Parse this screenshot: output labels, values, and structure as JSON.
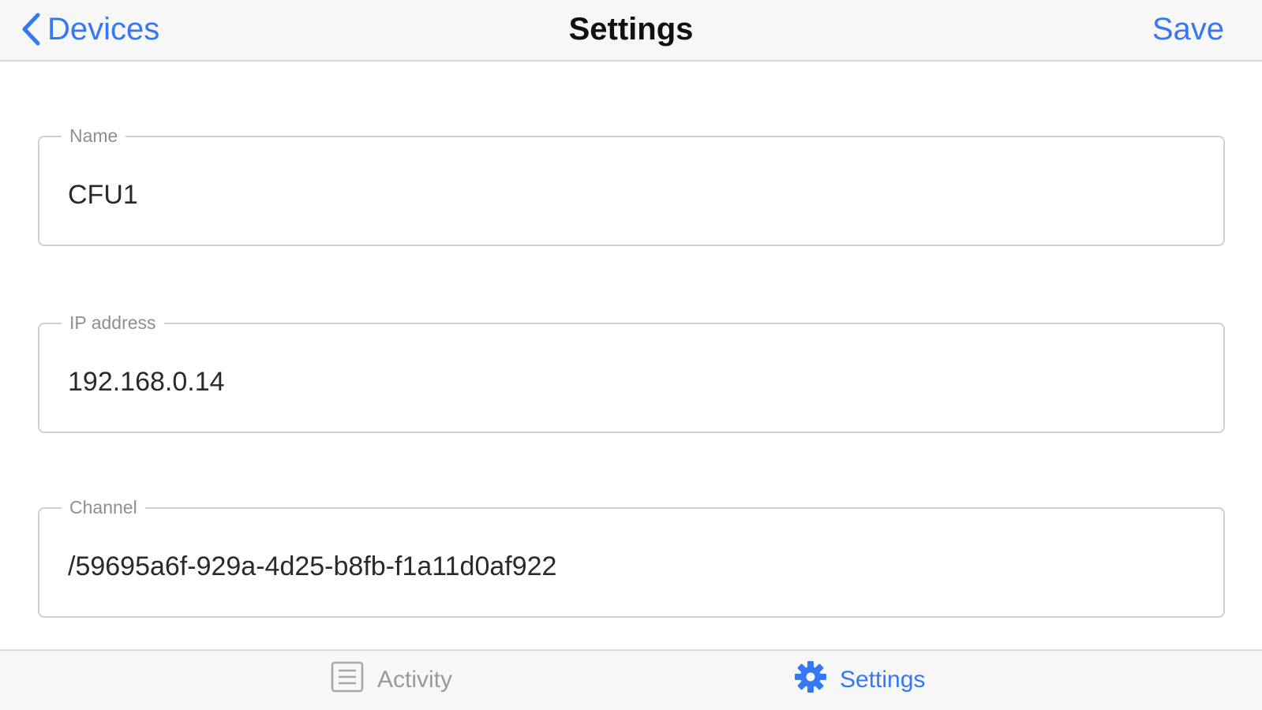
{
  "navbar": {
    "back_label": "Devices",
    "title": "Settings",
    "save_label": "Save"
  },
  "fields": [
    {
      "label": "Name",
      "value": "CFU1"
    },
    {
      "label": "IP address",
      "value": "192.168.0.14"
    },
    {
      "label": "Channel",
      "value": "/59695a6f-929a-4d25-b8fb-f1a11d0af922"
    }
  ],
  "tabbar": {
    "tabs": [
      {
        "label": "Activity",
        "icon": "list-icon",
        "active": false
      },
      {
        "label": "Settings",
        "icon": "gear-icon",
        "active": true
      }
    ]
  },
  "colors": {
    "accent": "#3478f6",
    "inactive": "#9a9a9a",
    "bar_background": "#f7f7f7",
    "border": "#cfcfcf"
  }
}
